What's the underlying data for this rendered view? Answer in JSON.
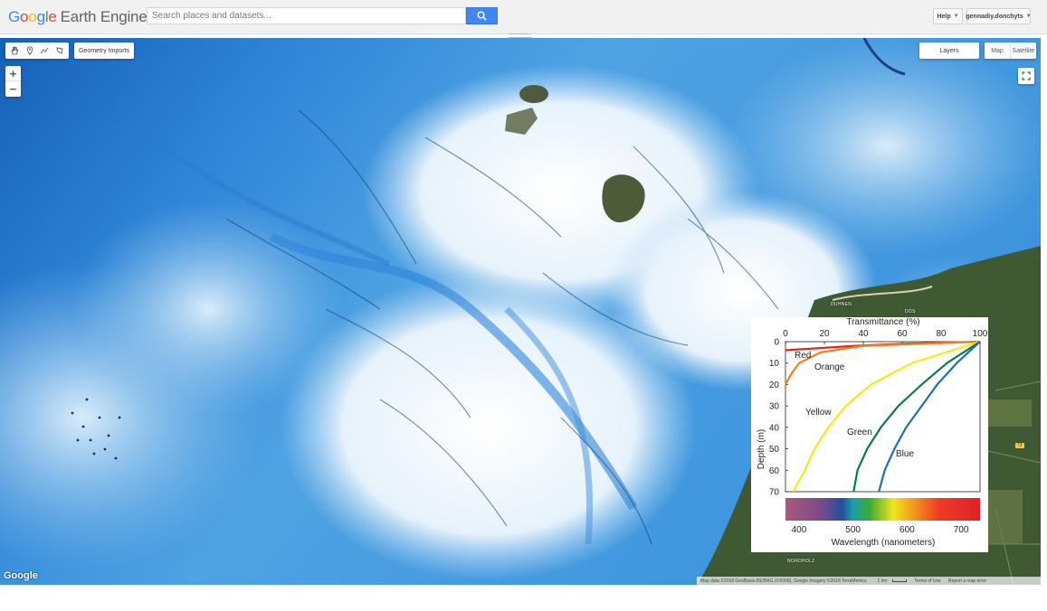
{
  "header": {
    "logo_letters": [
      "G",
      "o",
      "o",
      "g",
      "l",
      "e"
    ],
    "logo_suffix": "Earth Engine",
    "search_placeholder": "Search places and datasets...",
    "help_label": "Help",
    "account_label": "gennadiy.donchyts"
  },
  "map_controls": {
    "geometry_imports_label": "Geometry Imports",
    "zoom_in_label": "+",
    "zoom_out_label": "−",
    "layers_label": "Layers",
    "map_type_options": [
      "Map",
      "Satellite"
    ]
  },
  "map_labels": {
    "place_1": "DUHNEN",
    "place_2": "DÖS",
    "place_3": "NORDHOLZ",
    "road_shield": "73"
  },
  "map_footer": {
    "watermark": "Google",
    "attribution": "Map data ©2018 GeoBasis-DE/BKG (©2009), Google Imagery ©2018 TerraMetrics",
    "scale": "1 km",
    "terms": "Terms of Use",
    "report": "Report a map error"
  },
  "chart_data": {
    "type": "line",
    "title": "Transmittance (%)",
    "ylabel": "Depth (m)",
    "xlim": [
      0,
      100
    ],
    "ylim": [
      0,
      70
    ],
    "y_inverted": true,
    "x_ticks": [
      "0",
      "20",
      "40",
      "60",
      "80",
      "100"
    ],
    "y_ticks": [
      "0",
      "10",
      "20",
      "30",
      "40",
      "50",
      "60",
      "70"
    ],
    "series": [
      {
        "name": "Red",
        "color": "#d42a20",
        "depth": [
          0,
          1,
          2,
          3,
          4
        ],
        "transmittance": [
          100,
          60,
          35,
          18,
          0
        ]
      },
      {
        "name": "Orange",
        "color": "#f0821e",
        "depth": [
          0,
          2,
          5,
          10,
          15,
          20
        ],
        "transmittance": [
          100,
          40,
          18,
          7,
          3,
          0
        ]
      },
      {
        "name": "Yellow",
        "color": "#f5ea14",
        "depth": [
          0,
          10,
          20,
          30,
          40,
          50,
          60,
          70
        ],
        "transmittance": [
          100,
          65,
          44,
          31,
          22,
          15,
          10,
          4
        ]
      },
      {
        "name": "Green",
        "color": "#0a7a4a",
        "depth": [
          0,
          10,
          20,
          30,
          40,
          50,
          60,
          70
        ],
        "transmittance": [
          100,
          83,
          70,
          58,
          49,
          42,
          37,
          35
        ]
      },
      {
        "name": "Blue",
        "color": "#1f6fb5",
        "depth": [
          0,
          10,
          20,
          30,
          40,
          50,
          60,
          70
        ],
        "transmittance": [
          100,
          88,
          78,
          70,
          62,
          56,
          51,
          48
        ]
      }
    ],
    "spectrum": {
      "xlabel": "Wavelength (nanometers)",
      "ticks": [
        "400",
        "500",
        "600",
        "700"
      ],
      "range": [
        375,
        735
      ],
      "stops": [
        {
          "nm": 375,
          "color": "#a95a7c"
        },
        {
          "nm": 440,
          "color": "#7b4a8c"
        },
        {
          "nm": 480,
          "color": "#244f9a"
        },
        {
          "nm": 500,
          "color": "#1aa0a8"
        },
        {
          "nm": 530,
          "color": "#3aaa35"
        },
        {
          "nm": 575,
          "color": "#f2e51c"
        },
        {
          "nm": 610,
          "color": "#f39b1f"
        },
        {
          "nm": 660,
          "color": "#ee3b23"
        },
        {
          "nm": 735,
          "color": "#e0202a"
        }
      ]
    }
  }
}
